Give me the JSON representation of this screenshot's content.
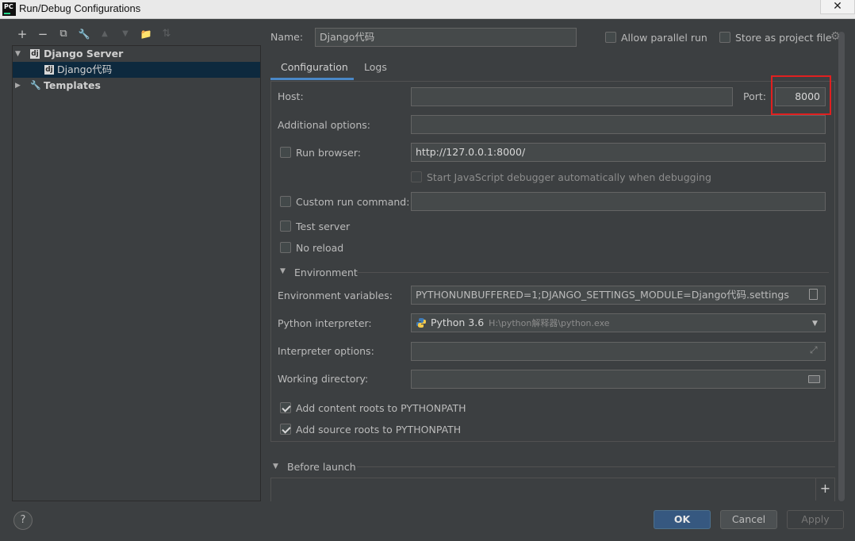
{
  "window": {
    "title": "Run/Debug Configurations",
    "logo_text": "PC",
    "close_glyph": "✕"
  },
  "toolbar": {
    "add": "+",
    "remove": "−",
    "copy": "⧉",
    "edit": "🔧",
    "up": "▲",
    "down": "▼",
    "folder": "📁",
    "sort": "⇅"
  },
  "tree": {
    "group_label": "Django Server",
    "child_label": "Django代码",
    "templates_label": "Templates",
    "dj_icon_text": "dj"
  },
  "name": {
    "label": "Name:",
    "value": "Django代码"
  },
  "allow_parallel": {
    "label": "Allow parallel run",
    "checked": false
  },
  "store_project": {
    "label": "Store as project file",
    "checked": false
  },
  "tabs": [
    {
      "label": "Configuration",
      "active": true
    },
    {
      "label": "Logs",
      "active": false
    }
  ],
  "config": {
    "host_label": "Host:",
    "host_value": "",
    "port_label": "Port:",
    "port_value": "8000",
    "additional_label": "Additional options:",
    "additional_value": "",
    "run_browser_label": "Run browser:",
    "run_browser_value": "http://127.0.0.1:8000/",
    "js_debugger_label": "Start JavaScript debugger automatically when debugging",
    "custom_cmd_label": "Custom run command:",
    "custom_cmd_value": "",
    "test_server_label": "Test server",
    "no_reload_label": "No reload",
    "environment_label": "Environment",
    "env_vars_label": "Environment variables:",
    "env_vars_value": "PYTHONUNBUFFERED=1;DJANGO_SETTINGS_MODULE=Django代码.settings",
    "interpreter_label": "Python interpreter:",
    "interpreter_name": "Python 3.6",
    "interpreter_path": "H:\\python解释器\\python.exe",
    "interp_options_label": "Interpreter options:",
    "interp_options_value": "",
    "working_dir_label": "Working directory:",
    "working_dir_value": "",
    "content_roots_label": "Add content roots to PYTHONPATH",
    "source_roots_label": "Add source roots to PYTHONPATH"
  },
  "before_launch": {
    "label": "Before launch",
    "add_glyph": "+"
  },
  "buttons": {
    "ok": "OK",
    "cancel": "Cancel",
    "apply": "Apply",
    "help": "?"
  },
  "colors": {
    "background": "#3c3f41",
    "selection": "#0d293e",
    "accent": "#4a88c7",
    "highlight_box": "#e02020"
  }
}
